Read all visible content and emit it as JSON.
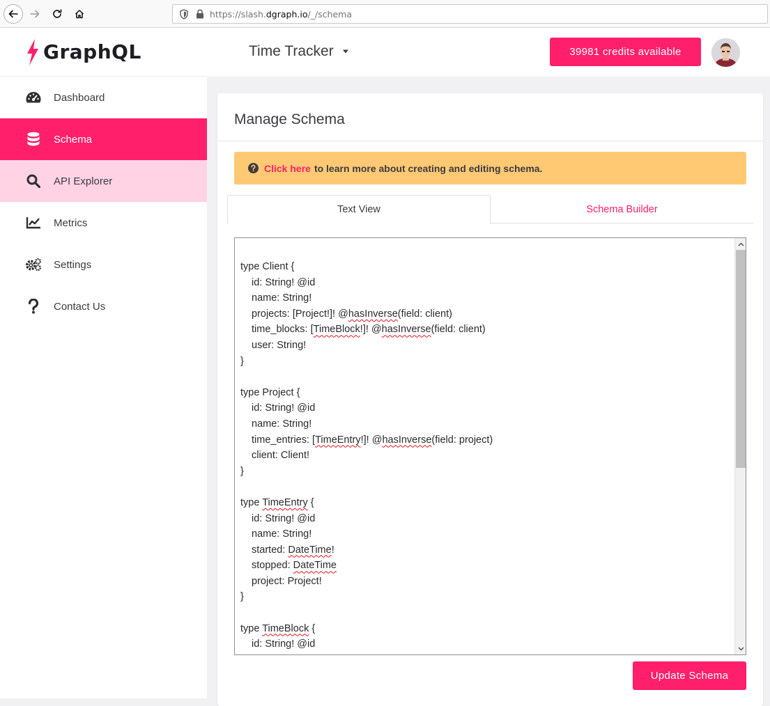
{
  "browser": {
    "url_prefix": "https://slash.",
    "url_host": "dgraph.io",
    "url_path": "/_/schema"
  },
  "sidebar": {
    "logo_text": "GraphQL",
    "items": [
      {
        "label": "Dashboard",
        "icon": "dashboard-icon",
        "state": "normal"
      },
      {
        "label": "Schema",
        "icon": "database-icon",
        "state": "active"
      },
      {
        "label": "API Explorer",
        "icon": "search-icon",
        "state": "hover"
      },
      {
        "label": "Metrics",
        "icon": "chart-line-icon",
        "state": "normal"
      },
      {
        "label": "Settings",
        "icon": "gears-icon",
        "state": "normal"
      },
      {
        "label": "Contact Us",
        "icon": "question-icon",
        "state": "normal"
      }
    ]
  },
  "header": {
    "project_name": "Time Tracker",
    "credits_label": "39981 credits available"
  },
  "main": {
    "title": "Manage Schema",
    "banner": {
      "link_text": "Click here",
      "text": "to learn more about creating and editing schema."
    },
    "tabs": [
      {
        "label": "Text View",
        "active": true
      },
      {
        "label": "Schema Builder",
        "active": false
      }
    ],
    "update_button": "Update Schema"
  },
  "schema_text": [
    "",
    "type Client {",
    "  id: String! @id",
    "  name: String!",
    "  projects: [Project!]! @hasInverse(field: client)",
    "  time_blocks: [TimeBlock!]! @hasInverse(field: client)",
    "  user: String!",
    "}",
    "",
    "type Project {",
    "  id: String! @id",
    "  name: String!",
    "  time_entries: [TimeEntry!]! @hasInverse(field: project)",
    "  client: Client!",
    "}",
    "",
    "type TimeEntry {",
    "  id: String! @id",
    "  name: String!",
    "  started: DateTime!",
    "  stopped: DateTime",
    "  project: Project!",
    "}",
    "",
    "type TimeBlock {",
    "  id: String! @id"
  ],
  "colors": {
    "accent": "#ff1f6b",
    "accent_light": "#ffd3e3",
    "banner": "#ffc973"
  }
}
